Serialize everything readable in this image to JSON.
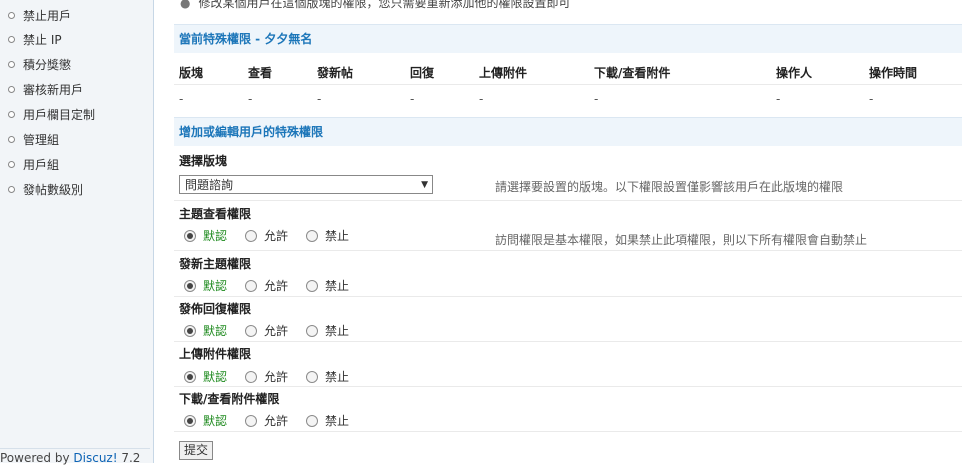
{
  "sidebar": {
    "items": [
      {
        "label": "禁止用戶"
      },
      {
        "label": "禁止 IP"
      },
      {
        "label": "積分獎懲"
      },
      {
        "label": "審核新用戶"
      },
      {
        "label": "用戶欄目定制"
      },
      {
        "label": "管理組"
      },
      {
        "label": "用戶組"
      },
      {
        "label": "發帖數級別"
      }
    ],
    "powered_prefix": "Powered by",
    "powered_brand": "Discuz!",
    "powered_version": "7.2"
  },
  "main": {
    "tip": "修改某個用戶在這個版塊的權限，您只需要重新添加他的權限設置即可",
    "current_title": "當前特殊權限 - 夕夕無名",
    "table": {
      "headers": [
        "版塊",
        "查看",
        "發新帖",
        "回復",
        "上傳附件",
        "下載/查看附件",
        "操作人",
        "操作時間"
      ],
      "row": [
        "-",
        "-",
        "-",
        "-",
        "-",
        "-",
        "-",
        "-"
      ]
    },
    "edit_title": "增加或編輯用戶的特殊權限",
    "forum_label": "選擇版塊",
    "forum_selected": "問題諮詢",
    "forum_hint": "請選擇要設置的版塊。以下權限設置僅影響該用戶在此版塊的權限",
    "permissions": [
      {
        "label": "主題查看權限",
        "hint": "訪問權限是基本權限，如果禁止此項權限，則以下所有權限會自動禁止"
      },
      {
        "label": "發新主題權限"
      },
      {
        "label": "發佈回復權限"
      },
      {
        "label": "上傳附件權限"
      },
      {
        "label": "下載/查看附件權限"
      }
    ],
    "options": {
      "default": "默認",
      "allow": "允許",
      "deny": "禁止"
    },
    "submit_label": "提交"
  }
}
